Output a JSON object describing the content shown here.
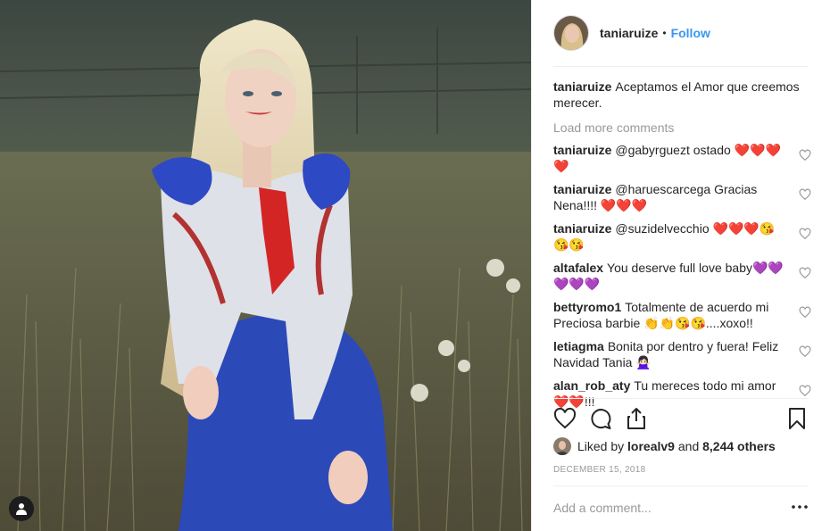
{
  "post_owner": {
    "username": "taniaruize",
    "separator": "•",
    "follow_label": "Follow"
  },
  "caption": {
    "username": "taniaruize",
    "text": "Aceptamos el Amor que creemos merecer."
  },
  "load_more_label": "Load more comments",
  "comments": [
    {
      "username": "taniaruize",
      "text": "@gabyrguezt ostado ❤️❤️❤️❤️"
    },
    {
      "username": "taniaruize",
      "text": "@haruescarcega Gracias Nena!!!! ❤️❤️❤️"
    },
    {
      "username": "taniaruize",
      "text": "@suzidelvecchio ❤️❤️❤️😘😘😘"
    },
    {
      "username": "altafalex",
      "text": "You deserve full love baby💜💜💜💜💜"
    },
    {
      "username": "bettyromo1",
      "text": "Totalmente de acuerdo mi Preciosa barbie 👏👏😘😘....xoxo!!"
    },
    {
      "username": "letiagma",
      "text": "Bonita por dentro y fuera! Feliz Navidad Tania 🙅🏻‍♀️"
    },
    {
      "username": "alan_rob_aty",
      "text": "Tu mereces todo mi amor ❤️❤️!!!"
    }
  ],
  "likes": {
    "prefix": "Liked by",
    "user": "lorealv9",
    "joiner": "and",
    "others": "8,244 others"
  },
  "date": "DECEMBER 15, 2018",
  "add_comment": {
    "placeholder": "Add a comment..."
  },
  "icons": {
    "like": "heart-outline-icon",
    "comment": "speech-bubble-icon",
    "share": "share-upload-icon",
    "save": "bookmark-icon",
    "more": "ellipsis-icon",
    "tag": "user-tag-icon"
  },
  "colors": {
    "accent": "#3897f0",
    "text": "#262626",
    "muted": "#999999",
    "divider": "#efefef"
  }
}
